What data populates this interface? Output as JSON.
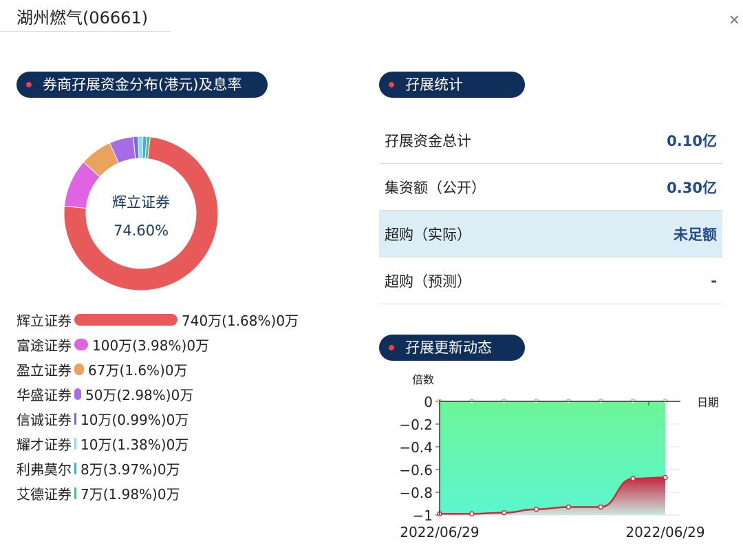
{
  "window": {
    "title": "湖州燃气(06661)",
    "close_symbol": "×"
  },
  "sections": {
    "distribution_title": "券商孖展资金分布(港元)及息率",
    "stats_title": "孖展统计",
    "dynamics_title": "孖展更新动态"
  },
  "donut": {
    "center_label": "辉立证券",
    "center_percent": "74.60%"
  },
  "brokers": [
    {
      "name": "辉立证券",
      "value": "740万(1.68%)0万",
      "amount": 740,
      "color": "#e85a5a"
    },
    {
      "name": "富途证券",
      "value": "100万(3.98%)0万",
      "amount": 100,
      "color": "#df63e2"
    },
    {
      "name": "盈立证券",
      "value": "67万(1.6%)0万",
      "amount": 67,
      "color": "#e9a35c"
    },
    {
      "name": "华盛证券",
      "value": "50万(2.98%)0万",
      "amount": 50,
      "color": "#a86be6"
    },
    {
      "name": "信诚证券",
      "value": "10万(0.99%)0万",
      "amount": 10,
      "color": "#6c70e0"
    },
    {
      "name": "耀才证券",
      "value": "10万(1.38%)0万",
      "amount": 10,
      "color": "#8fd9ef"
    },
    {
      "name": "利弗莫尔",
      "value": "8万(3.97%)0万",
      "amount": 8,
      "color": "#4ea6dc"
    },
    {
      "name": "艾德证券",
      "value": "7万(1.98%)0万",
      "amount": 7,
      "color": "#4fbf7c"
    }
  ],
  "stats": [
    {
      "label": "孖展资金总计",
      "value": "0.10亿"
    },
    {
      "label": "集资额（公开）",
      "value": "0.30亿"
    },
    {
      "label": "超购（实际）",
      "value": "未足额"
    },
    {
      "label": "超购（预测）",
      "value": "-"
    }
  ],
  "chart_data": {
    "type": "area",
    "ylabel": "倍数",
    "xlabel": "日期",
    "ylim": [
      -1,
      0
    ],
    "y_ticks": [
      "0",
      "−0.2",
      "−0.4",
      "−0.6",
      "−0.8",
      "−1"
    ],
    "x_tick_labels": [
      "2022/06/29",
      "2022/06/29"
    ],
    "series": [
      {
        "values": [
          0,
          0,
          0,
          0,
          0,
          0,
          0,
          0
        ],
        "color": "#5cf0a0"
      },
      {
        "values": [
          -0.99,
          -0.99,
          -0.98,
          -0.95,
          -0.93,
          -0.93,
          -0.68,
          -0.67
        ],
        "color": "#d0283e"
      }
    ]
  }
}
